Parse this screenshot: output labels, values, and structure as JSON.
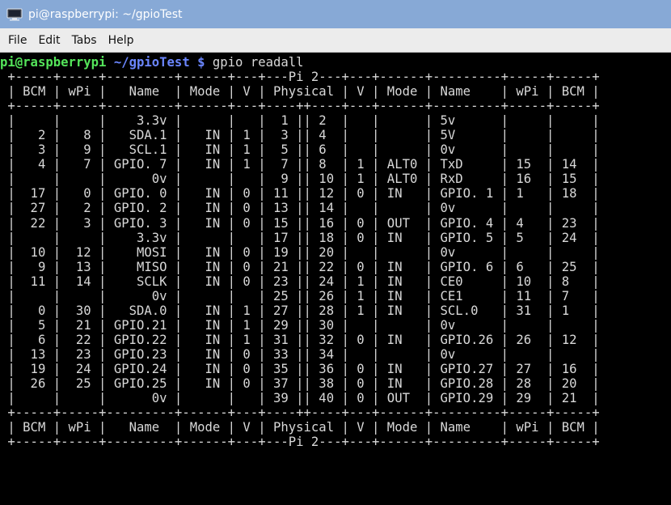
{
  "window": {
    "title": "pi@raspberrypi: ~/gpioTest",
    "icon": "terminal-icon"
  },
  "menubar": {
    "items": [
      "File",
      "Edit",
      "Tabs",
      "Help"
    ]
  },
  "terminal": {
    "prompt_user": "pi@raspberrypi",
    "prompt_path": "~/gpioTest",
    "prompt_symbol": "$",
    "command": "gpio readall",
    "output": [
      " +-----+-----+---------+------+---+---Pi 2---+---+------+---------+-----+-----+",
      " | BCM | wPi |   Name  | Mode | V | Physical | V | Mode | Name    | wPi | BCM |",
      " +-----+-----+---------+------+---+----++----+---+------+---------+-----+-----+",
      " |     |     |    3.3v |      |   |  1 || 2  |   |      | 5v      |     |     |",
      " |   2 |   8 |   SDA.1 |   IN | 1 |  3 || 4  |   |      | 5V      |     |     |",
      " |   3 |   9 |   SCL.1 |   IN | 1 |  5 || 6  |   |      | 0v      |     |     |",
      " |   4 |   7 | GPIO. 7 |   IN | 1 |  7 || 8  | 1 | ALT0 | TxD     | 15  | 14  |",
      " |     |     |      0v |      |   |  9 || 10 | 1 | ALT0 | RxD     | 16  | 15  |",
      " |  17 |   0 | GPIO. 0 |   IN | 0 | 11 || 12 | 0 | IN   | GPIO. 1 | 1   | 18  |",
      " |  27 |   2 | GPIO. 2 |   IN | 0 | 13 || 14 |   |      | 0v      |     |     |",
      " |  22 |   3 | GPIO. 3 |   IN | 0 | 15 || 16 | 0 | OUT  | GPIO. 4 | 4   | 23  |",
      " |     |     |    3.3v |      |   | 17 || 18 | 0 | IN   | GPIO. 5 | 5   | 24  |",
      " |  10 |  12 |    MOSI |   IN | 0 | 19 || 20 |   |      | 0v      |     |     |",
      " |   9 |  13 |    MISO |   IN | 0 | 21 || 22 | 0 | IN   | GPIO. 6 | 6   | 25  |",
      " |  11 |  14 |    SCLK |   IN | 0 | 23 || 24 | 1 | IN   | CE0     | 10  | 8   |",
      " |     |     |      0v |      |   | 25 || 26 | 1 | IN   | CE1     | 11  | 7   |",
      " |   0 |  30 |   SDA.0 |   IN | 1 | 27 || 28 | 1 | IN   | SCL.0   | 31  | 1   |",
      " |   5 |  21 | GPIO.21 |   IN | 1 | 29 || 30 |   |      | 0v      |     |     |",
      " |   6 |  22 | GPIO.22 |   IN | 1 | 31 || 32 | 0 | IN   | GPIO.26 | 26  | 12  |",
      " |  13 |  23 | GPIO.23 |   IN | 0 | 33 || 34 |   |      | 0v      |     |     |",
      " |  19 |  24 | GPIO.24 |   IN | 0 | 35 || 36 | 0 | IN   | GPIO.27 | 27  | 16  |",
      " |  26 |  25 | GPIO.25 |   IN | 0 | 37 || 38 | 0 | IN   | GPIO.28 | 28  | 20  |",
      " |     |     |      0v |      |   | 39 || 40 | 0 | OUT  | GPIO.29 | 29  | 21  |",
      " +-----+-----+---------+------+---+----++----+---+------+---------+-----+-----+",
      " | BCM | wPi |   Name  | Mode | V | Physical | V | Mode | Name    | wPi | BCM |",
      " +-----+-----+---------+------+---+---Pi 2---+---+------+---------+-----+-----+"
    ]
  },
  "colors": {
    "titlebar": "#87a9d6",
    "menubar": "#ececec",
    "terminal_bg": "#000000",
    "terminal_fg": "#d8d8d8",
    "prompt_user": "#54e45a",
    "prompt_path": "#6b86ff"
  }
}
